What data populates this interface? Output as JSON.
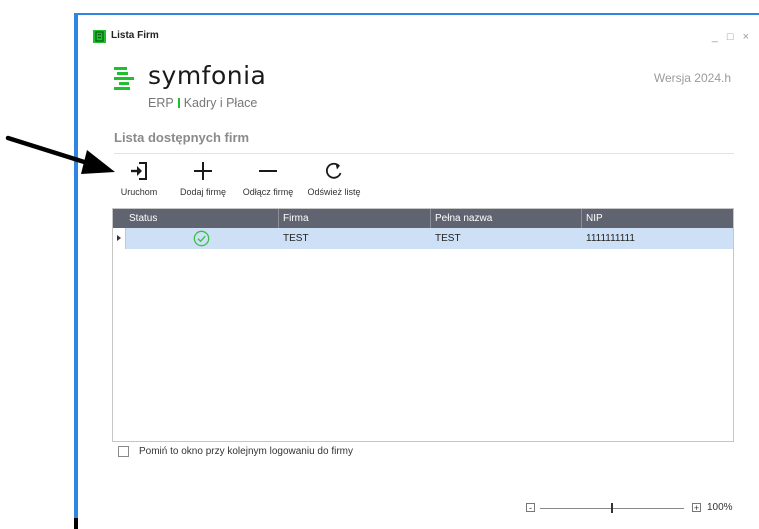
{
  "window": {
    "title": "Lista Firm",
    "controls": {
      "minimize": "_",
      "maximize": "□",
      "close": "×"
    }
  },
  "logo": {
    "name": "symfonia",
    "product_left": "ERP",
    "product_right": "Kadry i Płace"
  },
  "version": "Wersja 2024.h",
  "section_title": "Lista dostępnych firm",
  "toolbar": {
    "run": "Uruchom",
    "add": "Dodaj firmę",
    "detach": "Odłącz firmę",
    "refresh": "Odśwież listę"
  },
  "table": {
    "columns": [
      "Status",
      "Firma",
      "Pełna nazwa",
      "NIP"
    ],
    "rows": [
      {
        "status": "ok",
        "firma": "TEST",
        "pelna_nazwa": "TEST",
        "nip": "1111111111"
      }
    ]
  },
  "skip_checkbox": {
    "label": "Pomiń to okno przy kolejnym logowaniu do firmy",
    "checked": false
  },
  "zoom": {
    "minus": "-",
    "plus": "+",
    "value_label": "100%",
    "level_fraction": 0.5
  },
  "colors": {
    "accent": "#2f86e0",
    "brand_green": "#1fbf2f",
    "header_bg": "#5f6470",
    "selected_row": "#cde0f5"
  }
}
